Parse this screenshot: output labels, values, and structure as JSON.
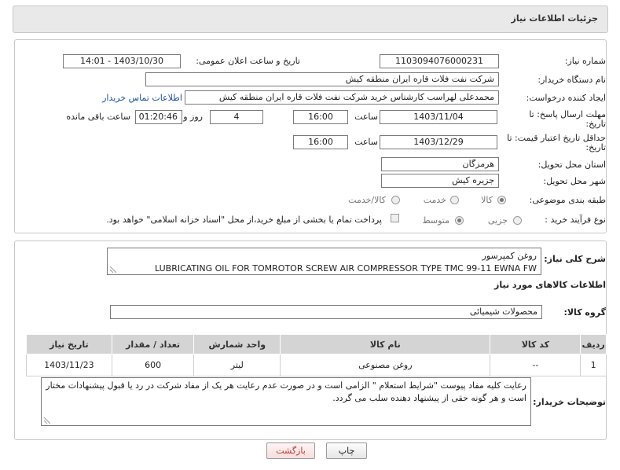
{
  "header": {
    "title": "جزئیات اطلاعات نیاز"
  },
  "form": {
    "need_number_label": "شماره نیاز:",
    "need_number": "1103094076000231",
    "announce_label": "تاریخ و ساعت اعلان عمومی:",
    "announce_value": "1403/10/30 - 14:01",
    "buyer_org_label": "نام دستگاه خریدار:",
    "buyer_org": "شرکت نفت فلات قاره ایران منطقه کیش",
    "creator_label": "ایجاد کننده درخواست:",
    "creator": "محمدعلی لهراسب کارشناس خرید شرکت نفت فلات قاره ایران منطقه کیش",
    "contact_link": "اطلاعات تماس خریدار",
    "deadline_label_1": "مهلت ارسال پاسخ: تا",
    "deadline_label_2": "تاریخ:",
    "deadline_date": "1403/11/04",
    "time_label": "ساعت",
    "deadline_time": "16:00",
    "days_value": "4",
    "days_label": "روز و",
    "remaining_value": "01:20:46",
    "remaining_label": "ساعت باقی مانده",
    "validity_label_1": "حداقل تاریخ اعتبار قیمت: تا",
    "validity_label_2": "تاریخ:",
    "validity_date": "1403/12/29",
    "validity_time": "16:00",
    "province_label": "استان محل تحویل:",
    "province": "هرمزگان",
    "city_label": "شهر محل تحویل:",
    "city": "جزیره کیش",
    "category_label": "طبقه بندی موضوعی:",
    "category_options": [
      "کالا",
      "خدمت",
      "کالا/خدمت"
    ],
    "process_label": "نوع فرآیند خرید :",
    "process_options": [
      "جزیی",
      "متوسط"
    ],
    "payment_note": "پرداخت تمام یا بخشی از مبلغ خرید،از محل \"اسناد خزانه اسلامی\" خواهد بود."
  },
  "description": {
    "label": "شرح کلی نیاز:",
    "line1": "روغن کمپرسور",
    "line2": "LUBRICATING OIL FOR TOMROTOR SCREW AIR COMPRESSOR TYPE TMC 99-11 EWNA FW"
  },
  "goods": {
    "section_title": "اطلاعات کالاهای مورد نیاز",
    "group_label": "گروه کالا:",
    "group_value": "محصولات شیمیائی",
    "columns": [
      "ردیف",
      "کد کالا",
      "نام کالا",
      "واحد شمارش",
      "تعداد / مقدار",
      "تاریخ نیاز"
    ],
    "rows": [
      [
        "1",
        "--",
        "روغن مصنوعی",
        "لیتر",
        "600",
        "1403/11/23"
      ]
    ]
  },
  "buyer_notes": {
    "label": "توضیحات خریدار:",
    "text": "رعایت کلیه مفاد  پیوست \"شرایط استعلام \" الزامی است و در صورت عدم رعایت هر یک از مفاد شرکت در رد یا قبول پیشنهادات مختار است  و هر گونه حقی از پیشنهاد دهنده سلب می گردد."
  },
  "buttons": {
    "print": "چاپ",
    "back": "بازگشت"
  },
  "colors": {
    "header_bg": "#e9e9e9",
    "table_header_bg": "#d4d4d4",
    "link": "#1a4e9c",
    "back_text": "#c0392b"
  }
}
